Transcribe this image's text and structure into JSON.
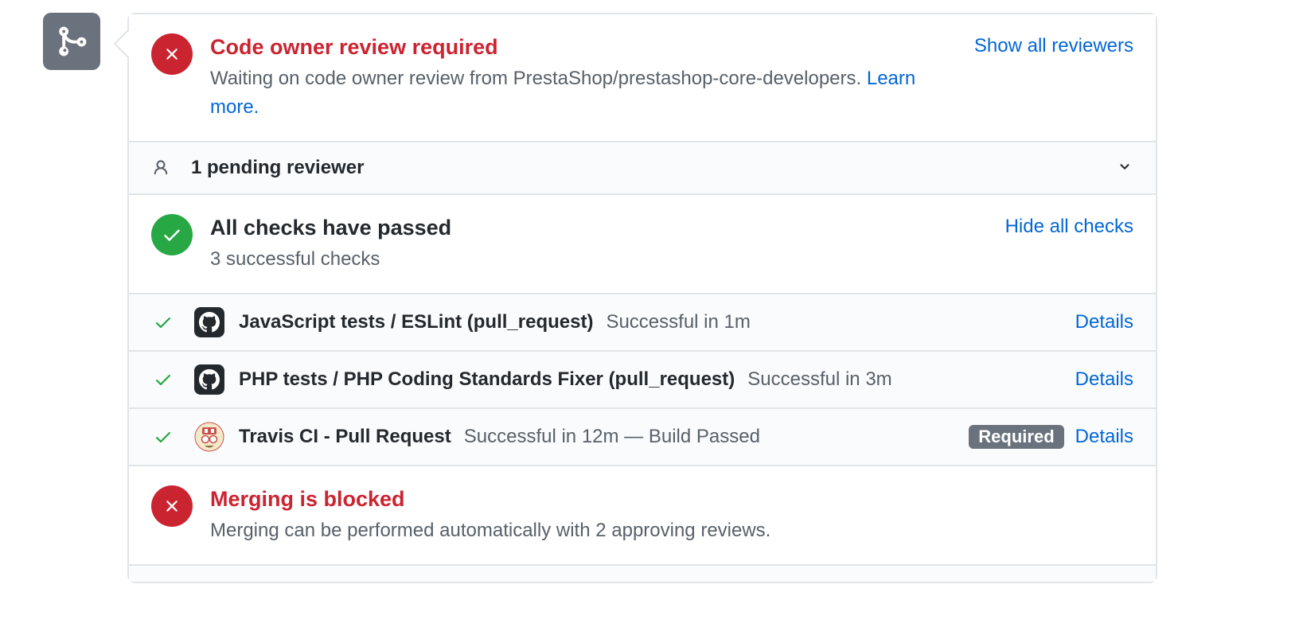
{
  "review": {
    "title": "Code owner review required",
    "subtitle_prefix": "Waiting on code owner review from PrestaShop/prestashop-core-developers. ",
    "learn_more": "Learn more.",
    "show_all": "Show all reviewers"
  },
  "pending": {
    "text": "1 pending reviewer"
  },
  "checks": {
    "title": "All checks have passed",
    "subtitle": "3 successful checks",
    "hide_all": "Hide all checks",
    "items": [
      {
        "name": "JavaScript tests / ESLint (pull_request)",
        "status": "Successful in 1m",
        "required": false,
        "avatar": "github",
        "details": "Details"
      },
      {
        "name": "PHP tests / PHP Coding Standards Fixer (pull_request)",
        "status": "Successful in 3m",
        "required": false,
        "avatar": "github",
        "details": "Details"
      },
      {
        "name": "Travis CI - Pull Request",
        "status": "Successful in 12m — Build Passed",
        "required": true,
        "avatar": "travis",
        "details": "Details"
      }
    ],
    "required_label": "Required"
  },
  "merge": {
    "title": "Merging is blocked",
    "subtitle": "Merging can be performed automatically with 2 approving reviews."
  }
}
